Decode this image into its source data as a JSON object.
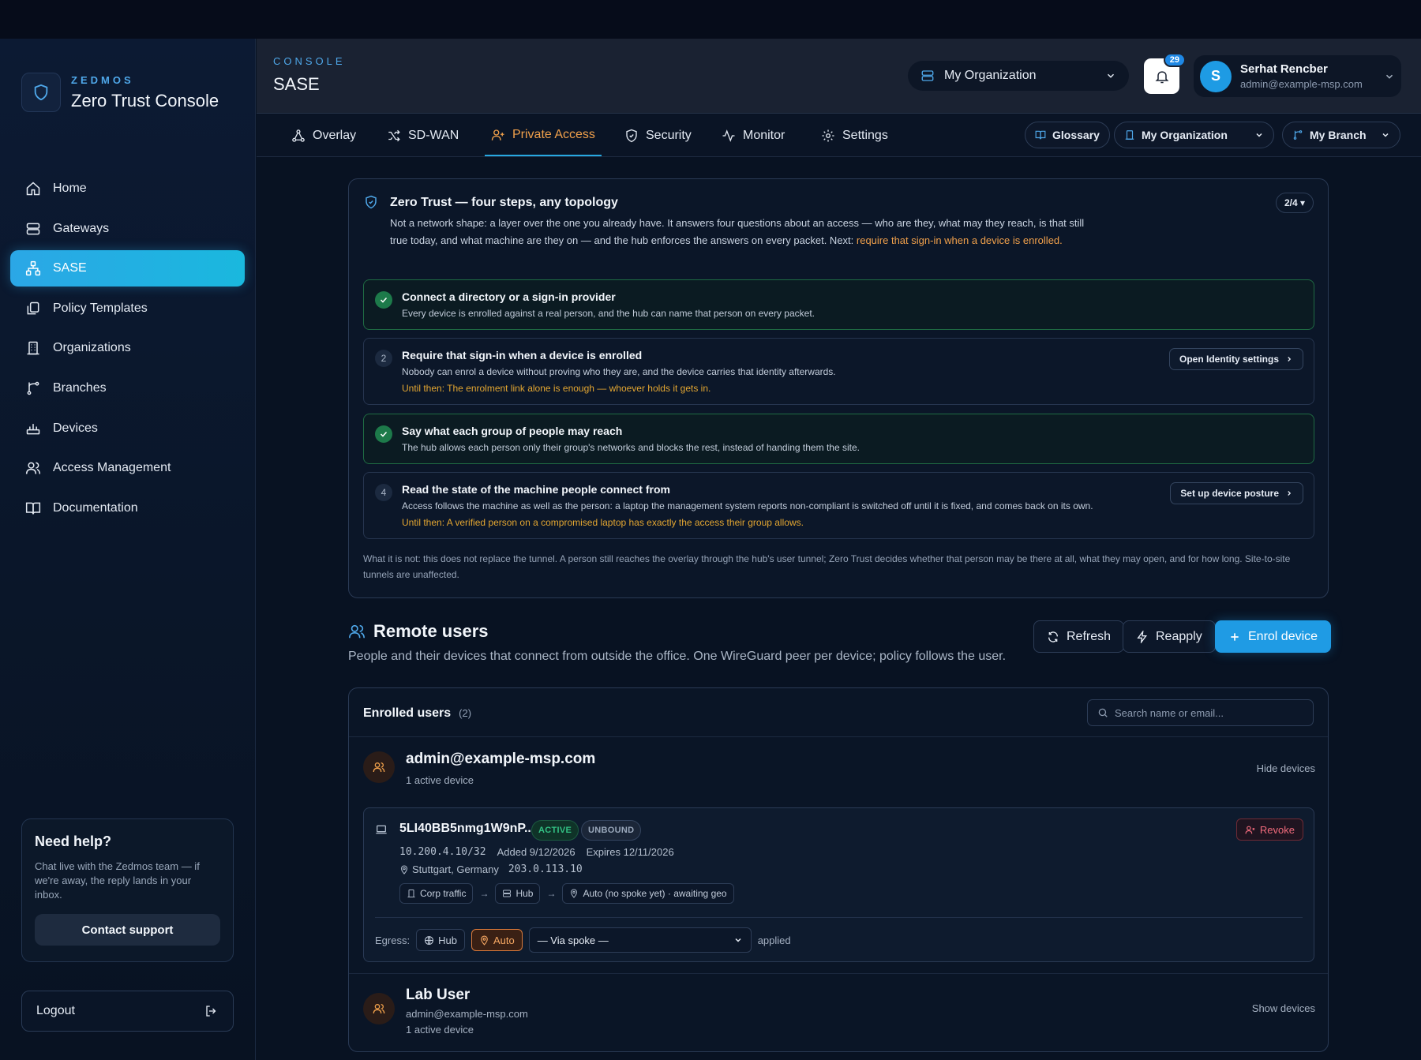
{
  "sidebar": {
    "brand_kicker": "ZEDMOS",
    "brand_title": "Zero Trust Console",
    "items": [
      {
        "label": "Home",
        "icon": "home-icon"
      },
      {
        "label": "Gateways",
        "icon": "server-icon"
      },
      {
        "label": "SASE",
        "icon": "network-icon",
        "active": true
      },
      {
        "label": "Policy Templates",
        "icon": "copy-icon"
      },
      {
        "label": "Organizations",
        "icon": "building-icon"
      },
      {
        "label": "Branches",
        "icon": "branch-icon"
      },
      {
        "label": "Devices",
        "icon": "router-icon"
      },
      {
        "label": "Access Management",
        "icon": "users-icon"
      },
      {
        "label": "Documentation",
        "icon": "book-icon"
      }
    ],
    "help": {
      "title": "Need help?",
      "text": "Chat live with the Zedmos team — if we're away, the reply lands in your inbox.",
      "button": "Contact support"
    },
    "logout": "Logout"
  },
  "header": {
    "kicker": "CONSOLE",
    "title": "SASE",
    "org_select": "My Organization",
    "notifications": "29",
    "user": {
      "initial": "S",
      "name": "Serhat Rencber",
      "email": "admin@example-msp.com"
    }
  },
  "tabs": [
    {
      "label": "Overlay",
      "icon": "overlay-icon"
    },
    {
      "label": "SD-WAN",
      "icon": "shuffle-icon"
    },
    {
      "label": "Private Access",
      "icon": "user-plus-icon",
      "active": true
    },
    {
      "label": "Security",
      "icon": "shield-icon"
    },
    {
      "label": "Monitor",
      "icon": "activity-icon"
    },
    {
      "label": "Settings",
      "icon": "gear-icon"
    }
  ],
  "toolbar": {
    "glossary": "Glossary",
    "org": "My Organization",
    "branch": "My Branch"
  },
  "zero_trust": {
    "title": "Zero Trust — four steps, any topology",
    "desc_main": "Not a network shape: a layer over the one you already have. It answers four questions about an access — who are they, what may they reach, is that still true today, and what machine are they on — and the hub enforces the answers on every packet. Next: ",
    "desc_next": "require that sign-in when a device is enrolled.",
    "counter": "2/4 ▾",
    "steps": [
      {
        "title": "Connect a directory or a sign-in provider",
        "desc": "Every device is enrolled against a real person, and the hub can name that person on every packet.",
        "done": true
      },
      {
        "number": "2",
        "title": "Require that sign-in when a device is enrolled",
        "desc": "Nobody can enrol a device without proving who they are, and the device carries that identity afterwards.",
        "warning": "Until then: The enrolment link alone is enough — whoever holds it gets in.",
        "button": "Open Identity settings"
      },
      {
        "title": "Say what each group of people may reach",
        "desc": "The hub allows each person only their group's networks and blocks the rest, instead of handing them the site.",
        "done": true
      },
      {
        "number": "4",
        "title": "Read the state of the machine people connect from",
        "desc": "Access follows the machine as well as the person: a laptop the management system reports non-compliant is switched off until it is fixed, and comes back on its own.",
        "warning": "Until then: A verified person on a compromised laptop has exactly the access their group allows.",
        "button": "Set up device posture"
      }
    ],
    "footer": "What it is not: this does not replace the tunnel. A person still reaches the overlay through the hub's user tunnel; Zero Trust decides whether that person may be there at all, what they may open, and for how long. Site-to-site tunnels are unaffected."
  },
  "remote_users": {
    "title": "Remote users",
    "subtitle": "People and their devices that connect from outside the office. One WireGuard peer per device; policy follows the user.",
    "refresh": "Refresh",
    "reapply": "Reapply",
    "enrol": "Enrol device"
  },
  "enrolled": {
    "title": "Enrolled users",
    "count": "(2)",
    "search_placeholder": "Search name or email...",
    "users": [
      {
        "name": "admin@example-msp.com",
        "meta": "1 active device",
        "toggle": "Hide devices"
      },
      {
        "name": "Lab User",
        "email": "admin@example-msp.com",
        "meta": "1 active device",
        "toggle": "Show devices"
      }
    ],
    "device": {
      "name": "5LI40BB5nmg1W9nP...",
      "status": "ACTIVE",
      "binding": "UNBOUND",
      "revoke": "Revoke",
      "ip": "10.200.4.10/32",
      "added": "Added 9/12/2026",
      "expires": "Expires 12/11/2026",
      "location": "Stuttgart, Germany",
      "public_ip": "203.0.113.10",
      "flow": [
        "Corp traffic",
        "Hub",
        "Auto (no spoke yet) · awaiting geo"
      ],
      "egress_label": "Egress:",
      "egress_hub": "Hub",
      "egress_auto": "Auto",
      "via_spoke": "— Via spoke —",
      "applied": "applied"
    }
  },
  "colors": {
    "accent": "#1f9be4",
    "warning": "#f0a04b",
    "success": "#33c184",
    "danger": "#f06b7c"
  }
}
